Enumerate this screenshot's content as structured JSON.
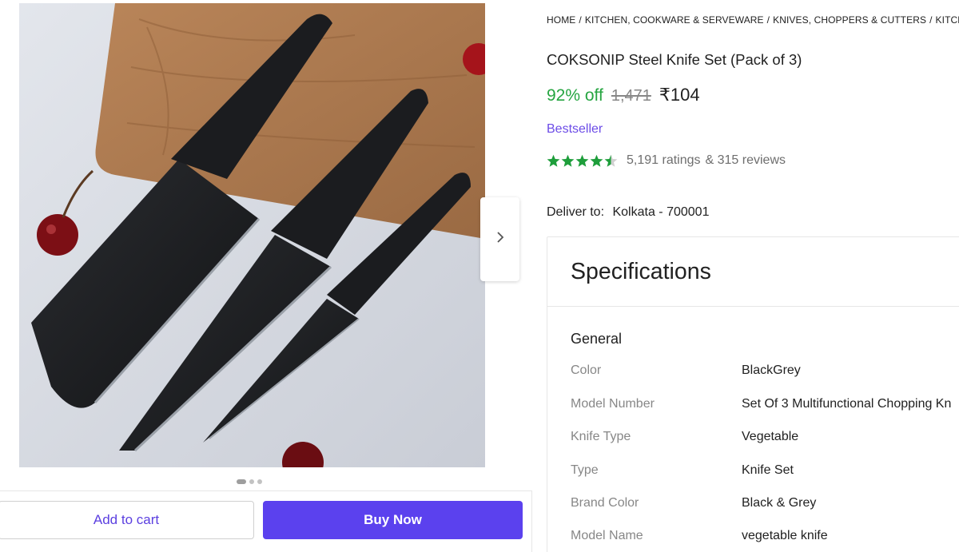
{
  "breadcrumb": [
    "HOME",
    "KITCHEN, COOKWARE & SERVEWARE",
    "KNIVES, CHOPPERS & CUTTERS",
    "KITCHEN"
  ],
  "product": {
    "title": "COKSONIP Steel Knife Set (Pack of 3)",
    "discount": "92% off",
    "mrp": "1,471",
    "price": "₹104",
    "badge": "Bestseller",
    "rating_stars": 4.5,
    "ratings": "5,191 ratings",
    "reviews": "& 315 reviews"
  },
  "delivery": {
    "label": "Deliver to:",
    "location": "Kolkata - 700001"
  },
  "gallery": {
    "image_count": 3,
    "active_index": 0,
    "next_icon": "chevron-right-icon"
  },
  "actions": {
    "add_to_cart": "Add to cart",
    "buy_now": "Buy Now"
  },
  "specifications": {
    "heading": "Specifications",
    "group": "General",
    "rows": [
      {
        "key": "Color",
        "value": "BlackGrey"
      },
      {
        "key": "Model Number",
        "value": "Set Of 3 Multifunctional Chopping Kn"
      },
      {
        "key": "Knife Type",
        "value": "Vegetable"
      },
      {
        "key": "Type",
        "value": "Knife Set"
      },
      {
        "key": "Brand Color",
        "value": "Black & Grey"
      },
      {
        "key": "Model Name",
        "value": "vegetable knife"
      }
    ]
  },
  "colors": {
    "accent": "#5b41ee",
    "discount_green": "#26a541",
    "star_green": "#1e9e3b",
    "bestseller_purple": "#6c4ce7"
  }
}
